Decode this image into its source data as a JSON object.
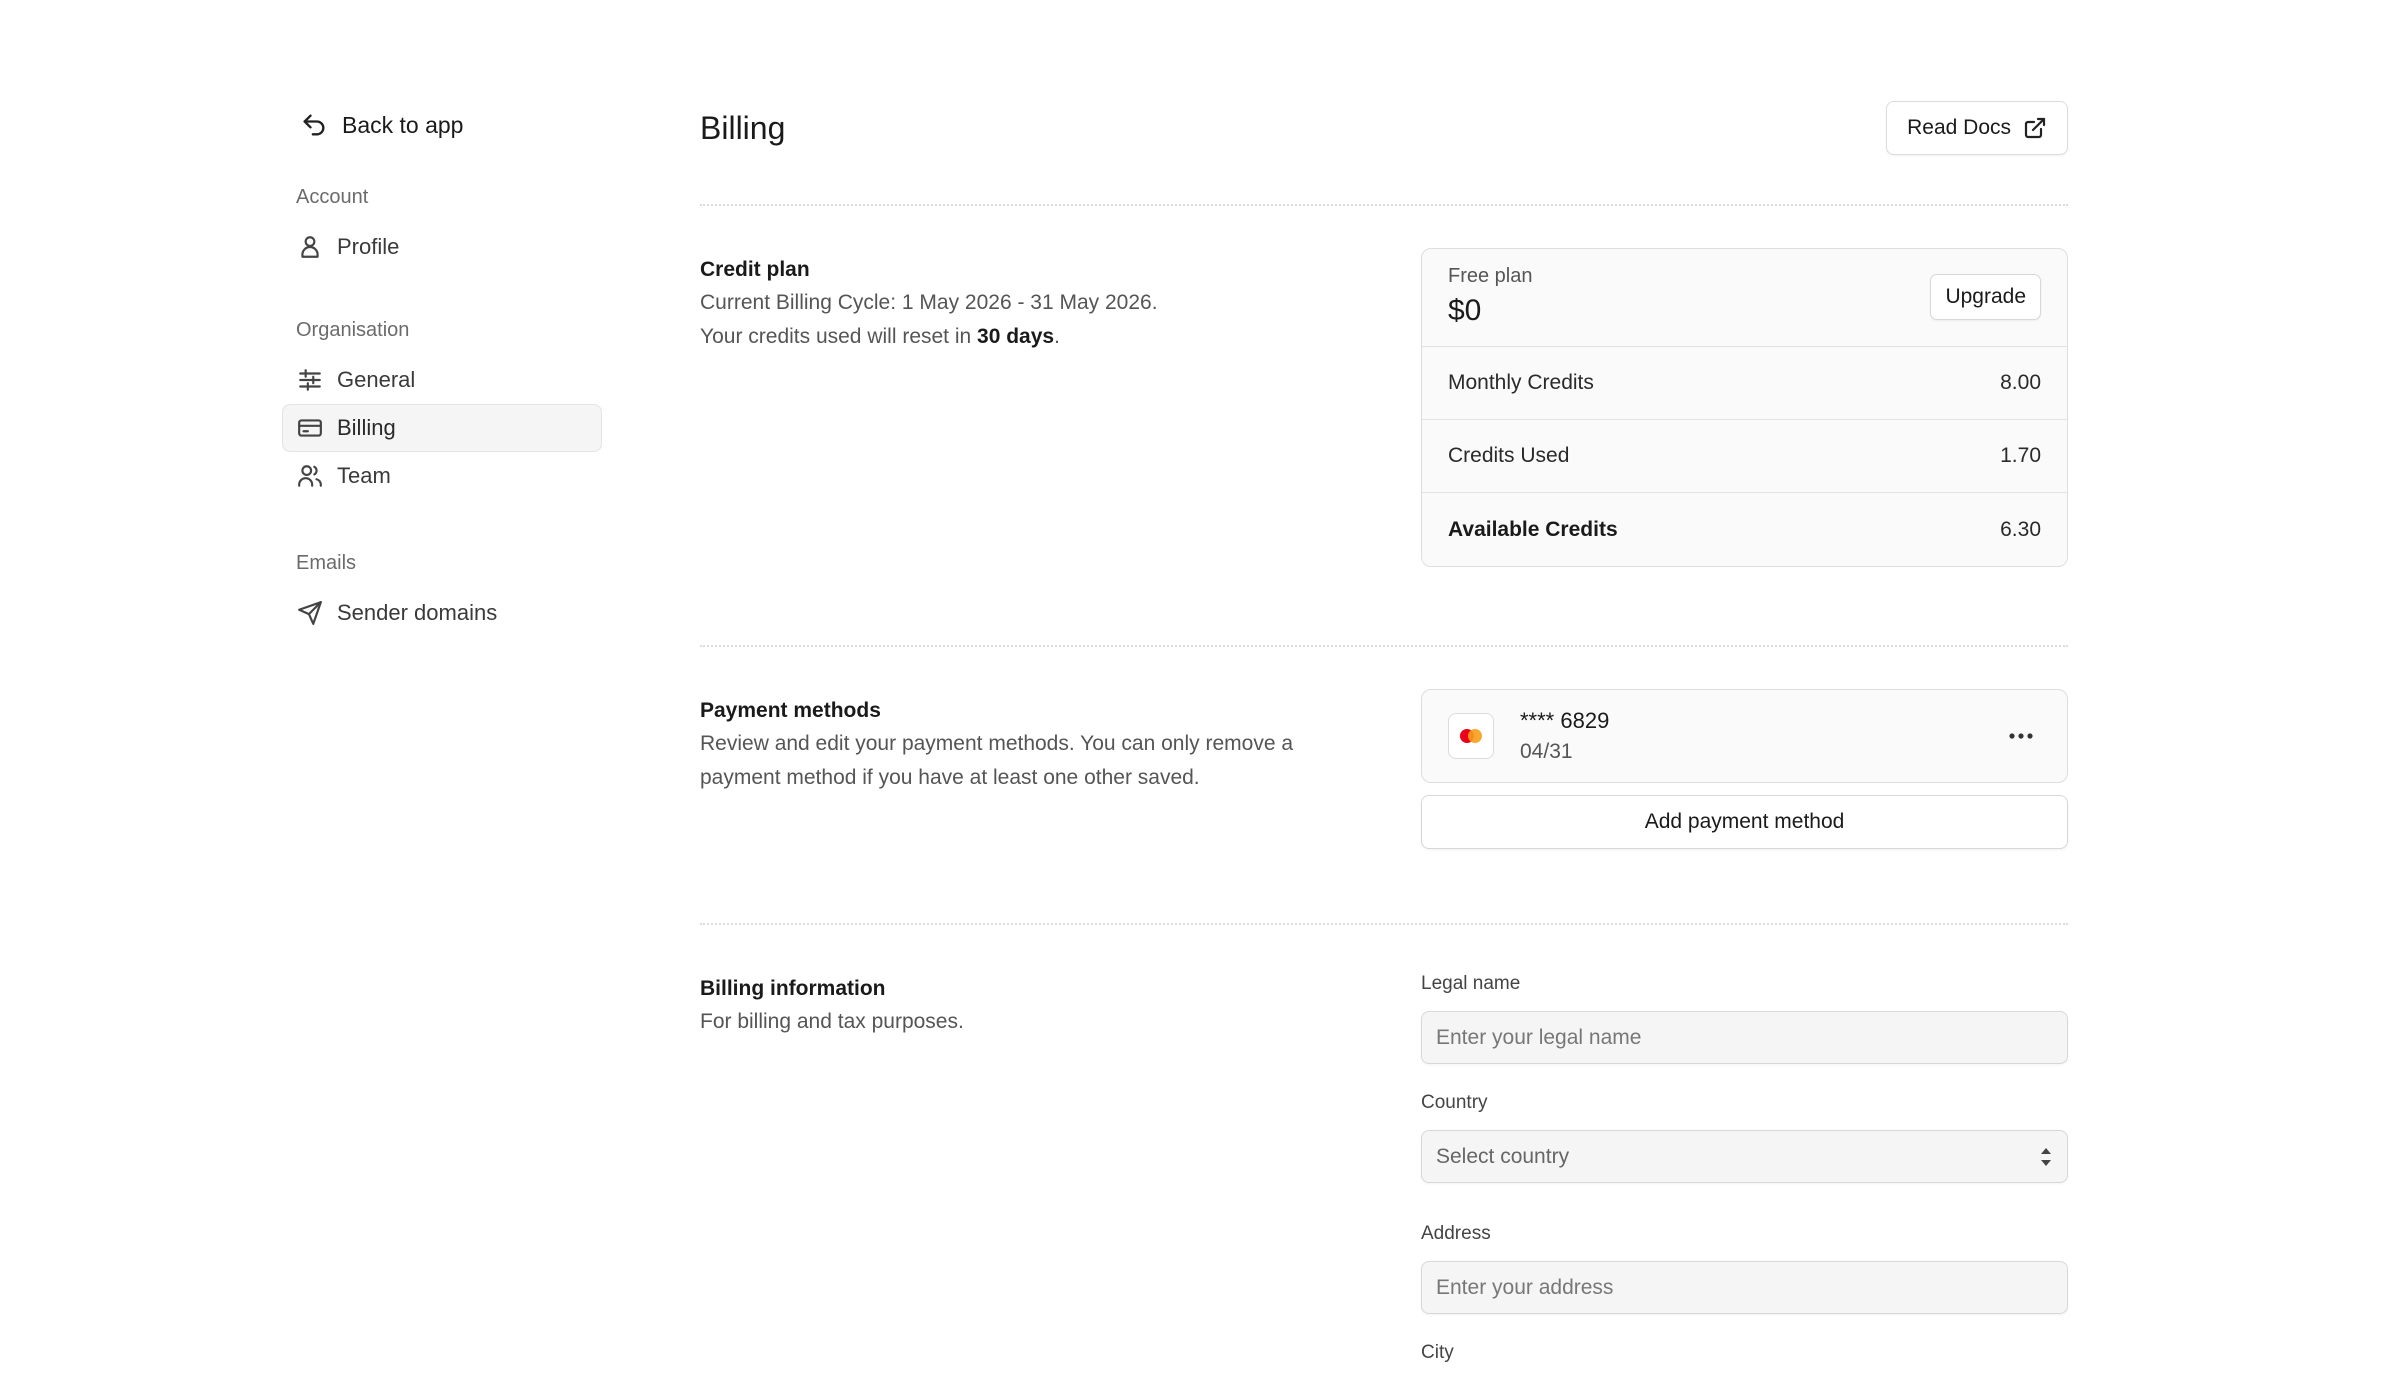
{
  "sidebar": {
    "back_label": "Back to app",
    "groups": [
      {
        "label": "Account",
        "items": [
          {
            "label": "Profile",
            "icon": "user-icon"
          }
        ]
      },
      {
        "label": "Organisation",
        "items": [
          {
            "label": "General",
            "icon": "sliders-icon"
          },
          {
            "label": "Billing",
            "icon": "credit-card-icon",
            "active": true
          },
          {
            "label": "Team",
            "icon": "users-icon"
          }
        ]
      },
      {
        "label": "Emails",
        "items": [
          {
            "label": "Sender domains",
            "icon": "send-icon"
          }
        ]
      }
    ]
  },
  "header": {
    "title": "Billing",
    "docs_label": "Read Docs"
  },
  "credit_plan": {
    "title": "Credit plan",
    "cycle_text": "Current Billing Cycle: 1 May 2026 - 31 May 2026.",
    "reset_prefix": "Your credits used will reset in ",
    "reset_days": "30 days",
    "reset_suffix": ".",
    "plan_name": "Free plan",
    "plan_price": "$0",
    "upgrade_label": "Upgrade",
    "rows": [
      {
        "label": "Monthly Credits",
        "value": "8.00"
      },
      {
        "label": "Credits Used",
        "value": "1.70"
      },
      {
        "label": "Available Credits",
        "value": "6.30"
      }
    ]
  },
  "payment": {
    "title": "Payment methods",
    "description": "Review and edit your payment methods. You can only remove a payment method if you have at least one other saved.",
    "card_number": "**** 6829",
    "card_expiry": "04/31",
    "card_brand_icon": "mastercard-icon",
    "add_label": "Add payment method"
  },
  "billing_info": {
    "title": "Billing information",
    "description": "For billing and tax purposes.",
    "legal_name_label": "Legal name",
    "legal_name_placeholder": "Enter your legal name",
    "country_label": "Country",
    "country_placeholder": "Select country",
    "address_label": "Address",
    "address_placeholder": "Enter your address",
    "city_label": "City"
  },
  "colors": {
    "mastercard_red": "#eb001b",
    "mastercard_orange": "#f79e1b"
  }
}
